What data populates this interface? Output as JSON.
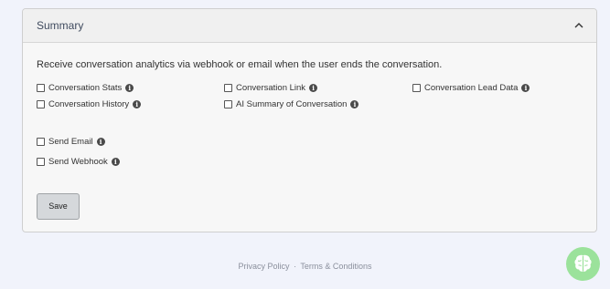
{
  "panel": {
    "title": "Summary",
    "description": "Receive conversation analytics via webhook or email when the user ends the conversation.",
    "collapse_icon": "chevron-up-icon"
  },
  "options": [
    {
      "label": "Conversation Stats",
      "checked": false
    },
    {
      "label": "Conversation Link",
      "checked": false
    },
    {
      "label": "Conversation Lead Data",
      "checked": false
    },
    {
      "label": "Conversation History",
      "checked": false
    },
    {
      "label": "AI Summary of Conversation",
      "checked": false
    },
    {
      "label": "Send Email",
      "checked": false
    },
    {
      "label": "Send Webhook",
      "checked": false
    }
  ],
  "info_icon": "i",
  "save_label": "Save",
  "footer": {
    "privacy": "Privacy Policy",
    "separator": "·",
    "terms": "Terms & Conditions"
  },
  "chat_widget": {
    "icon": "brain-icon",
    "color": "#9be29b"
  }
}
